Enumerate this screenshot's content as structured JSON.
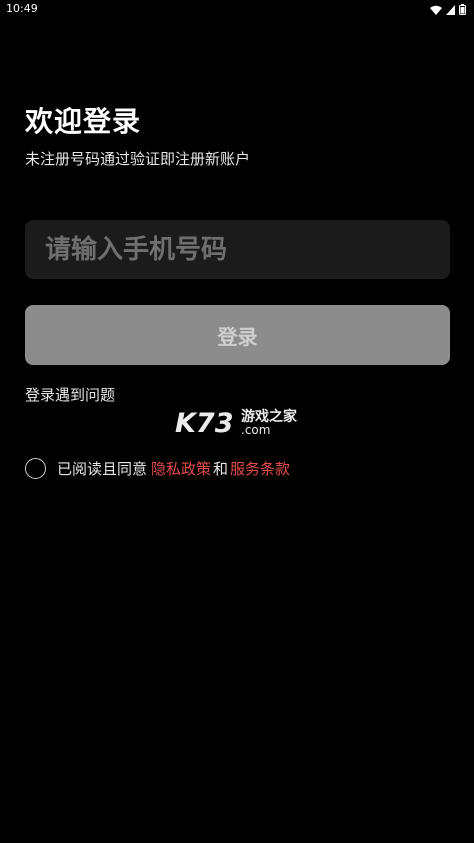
{
  "status_bar": {
    "time": "10:49",
    "icons": [
      "wifi-icon",
      "cell-signal-icon",
      "battery-icon"
    ]
  },
  "login": {
    "title": "欢迎登录",
    "subtitle": "未注册号码通过验证即注册新账户",
    "phone_placeholder": "请输入手机号码",
    "phone_value": "",
    "submit_label": "登录",
    "help_label": "登录遇到问题"
  },
  "agreement": {
    "checked": false,
    "prefix": "已阅读且同意",
    "privacy_label": "隐私政策",
    "and": "和",
    "terms_label": "服务条款"
  },
  "watermark": {
    "brand": "K73",
    "tagline": "游戏之家",
    "domain": ".com"
  },
  "colors": {
    "background": "#000000",
    "input_bg": "#1b1b1b",
    "button_disabled_bg": "#8c8c8c",
    "link_red": "#e44b4b"
  }
}
